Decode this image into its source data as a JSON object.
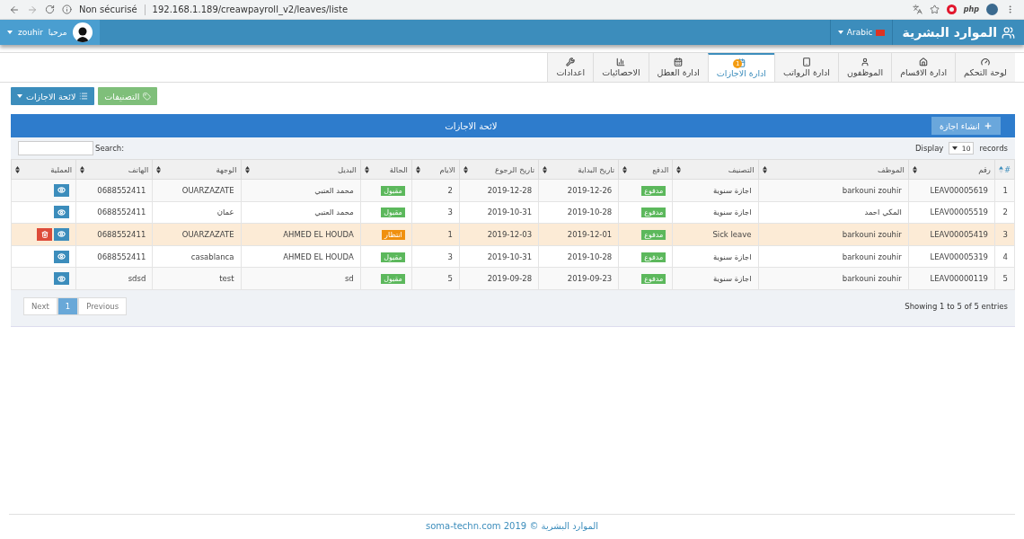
{
  "browser": {
    "security": "Non sécurisé",
    "url": "192.168.1.189/creawpayroll_v2/leaves/liste",
    "badge": "php"
  },
  "header": {
    "brand": "الموارد البشرية",
    "language": "Arabic",
    "greeting": "مرحبا",
    "user": "zouhir"
  },
  "tabs": [
    {
      "label": "لوحة التحكم",
      "selected": false
    },
    {
      "label": "ادارة الاقسام",
      "selected": false
    },
    {
      "label": "الموظفون",
      "selected": false
    },
    {
      "label": "ادارة الرواتب",
      "selected": false
    },
    {
      "label": "ادارة الاجازات",
      "selected": true,
      "badge": "1"
    },
    {
      "label": "ادارة العطل",
      "selected": false
    },
    {
      "label": "الاحصائيات",
      "selected": false
    },
    {
      "label": "اعدادات",
      "selected": false
    }
  ],
  "toolbar": {
    "list_button": "لائحة الاجازات",
    "categories_button": "التصنيفات"
  },
  "panel": {
    "title": "لائحة الاجازات",
    "create_button": "انشاء اجازة",
    "display_label": "Display",
    "page_size": "10",
    "records_label": "records",
    "search_label": "Search:"
  },
  "columns": [
    {
      "label": "#",
      "sorted": true
    },
    {
      "label": "رقم",
      "sorted": false
    },
    {
      "label": "الموظف",
      "sorted": false
    },
    {
      "label": "التصنيف",
      "sorted": false
    },
    {
      "label": "الدفع",
      "sorted": false
    },
    {
      "label": "تاريخ البداية",
      "sorted": false
    },
    {
      "label": "تاريخ الرجوع",
      "sorted": false
    },
    {
      "label": "الايام",
      "sorted": false
    },
    {
      "label": "الحالة",
      "sorted": false
    },
    {
      "label": "البديل",
      "sorted": false
    },
    {
      "label": "الوجهة",
      "sorted": false
    },
    {
      "label": "الهاتف",
      "sorted": false
    },
    {
      "label": "العملية",
      "sorted": false
    }
  ],
  "rows": [
    {
      "index": "1",
      "number": "LEAV00005619",
      "employee": "barkouni zouhir",
      "category": "اجازة سنوية",
      "payment": "مدفوع",
      "start": "2019-12-26",
      "return": "2019-12-28",
      "days": "2",
      "status": {
        "text": "مقبول",
        "kind": "accepted"
      },
      "substitute": "محمد العتبي",
      "destination": "OUARZAZATE",
      "phone": "0688552411",
      "highlighted": false,
      "deletable": false
    },
    {
      "index": "2",
      "number": "LEAV00005519",
      "employee": "المكي احمد",
      "category": "اجازة سنوية",
      "payment": "مدفوع",
      "start": "2019-10-28",
      "return": "2019-10-31",
      "days": "3",
      "status": {
        "text": "مقبول",
        "kind": "accepted"
      },
      "substitute": "محمد العتبي",
      "destination": "عمان",
      "phone": "0688552411",
      "highlighted": false,
      "deletable": false
    },
    {
      "index": "3",
      "number": "LEAV00005419",
      "employee": "barkouni zouhir",
      "category": "Sick leave",
      "payment": "مدفوع",
      "start": "2019-12-01",
      "return": "2019-12-03",
      "days": "1",
      "status": {
        "text": "انتظار",
        "kind": "pending"
      },
      "substitute": "AHMED EL HOUDA",
      "destination": "OUARZAZATE",
      "phone": "0688552411",
      "highlighted": true,
      "deletable": true
    },
    {
      "index": "4",
      "number": "LEAV00005319",
      "employee": "barkouni zouhir",
      "category": "اجازة سنوية",
      "payment": "مدفوع",
      "start": "2019-10-28",
      "return": "2019-10-31",
      "days": "3",
      "status": {
        "text": "مقبول",
        "kind": "accepted"
      },
      "substitute": "AHMED EL HOUDA",
      "destination": "casablanca",
      "phone": "0688552411",
      "highlighted": false,
      "deletable": false
    },
    {
      "index": "5",
      "number": "LEAV00000119",
      "employee": "barkouni zouhir",
      "category": "اجازة سنوية",
      "payment": "مدفوع",
      "start": "2019-09-23",
      "return": "2019-09-28",
      "days": "5",
      "status": {
        "text": "مقبول",
        "kind": "accepted"
      },
      "substitute": "sd",
      "destination": "test",
      "phone": "sdsd",
      "highlighted": false,
      "deletable": false
    }
  ],
  "info": "Showing 1 to 5 of 5 entries",
  "pagination": [
    {
      "label": "Previous",
      "selected": false
    },
    {
      "label": "1",
      "selected": true
    },
    {
      "label": "Next",
      "selected": false
    }
  ],
  "footer": "soma-techn.com 2019 © الموارد البشرية"
}
